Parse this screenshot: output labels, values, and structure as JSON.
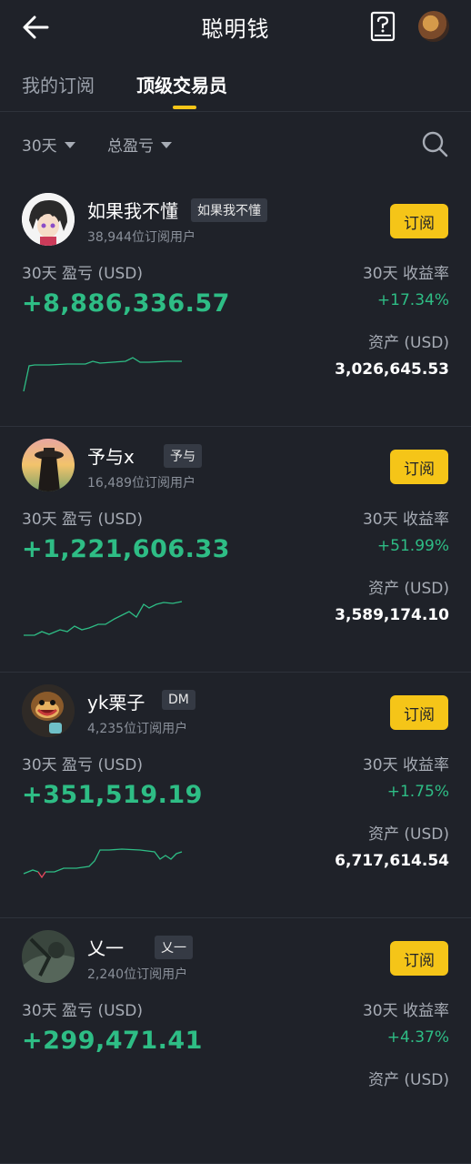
{
  "header": {
    "title": "聪明钱",
    "back_icon": "arrow-left-icon",
    "help_icon": "help-book-icon"
  },
  "tabs": [
    {
      "label": "我的订阅",
      "active": false
    },
    {
      "label": "顶级交易员",
      "active": true
    }
  ],
  "filters": {
    "period": "30天",
    "sort": "总盈亏"
  },
  "accent_color": "#f5c518",
  "positive_color": "#2ebd85",
  "traders": [
    {
      "name": "如果我不懂",
      "tag": "如果我不懂",
      "subscribers": "38,944位订阅用户",
      "subscribe_label": "订阅",
      "pnl_label": "30天 盈亏 (USD)",
      "pnl": "+8,886,336.57",
      "roi_label": "30天 收益率",
      "roi": "+17.34%",
      "asset_label": "资产 (USD)",
      "assets": "3,026,645.53"
    },
    {
      "name": "予与x",
      "tag": "予与",
      "subscribers": "16,489位订阅用户",
      "subscribe_label": "订阅",
      "pnl_label": "30天 盈亏 (USD)",
      "pnl": "+1,221,606.33",
      "roi_label": "30天 收益率",
      "roi": "+51.99%",
      "asset_label": "资产 (USD)",
      "assets": "3,589,174.10"
    },
    {
      "name": "yk栗子",
      "tag": "DM",
      "subscribers": "4,235位订阅用户",
      "subscribe_label": "订阅",
      "pnl_label": "30天 盈亏 (USD)",
      "pnl": "+351,519.19",
      "roi_label": "30天 收益率",
      "roi": "+1.75%",
      "asset_label": "资产 (USD)",
      "assets": "6,717,614.54"
    },
    {
      "name": "乂一",
      "tag": "乂一",
      "subscribers": "2,240位订阅用户",
      "subscribe_label": "订阅",
      "pnl_label": "30天 盈亏 (USD)",
      "pnl": "+299,471.41",
      "roi_label": "30天 收益率",
      "roi": "+4.37%",
      "asset_label": "资产 (USD)",
      "assets": ""
    }
  ]
}
